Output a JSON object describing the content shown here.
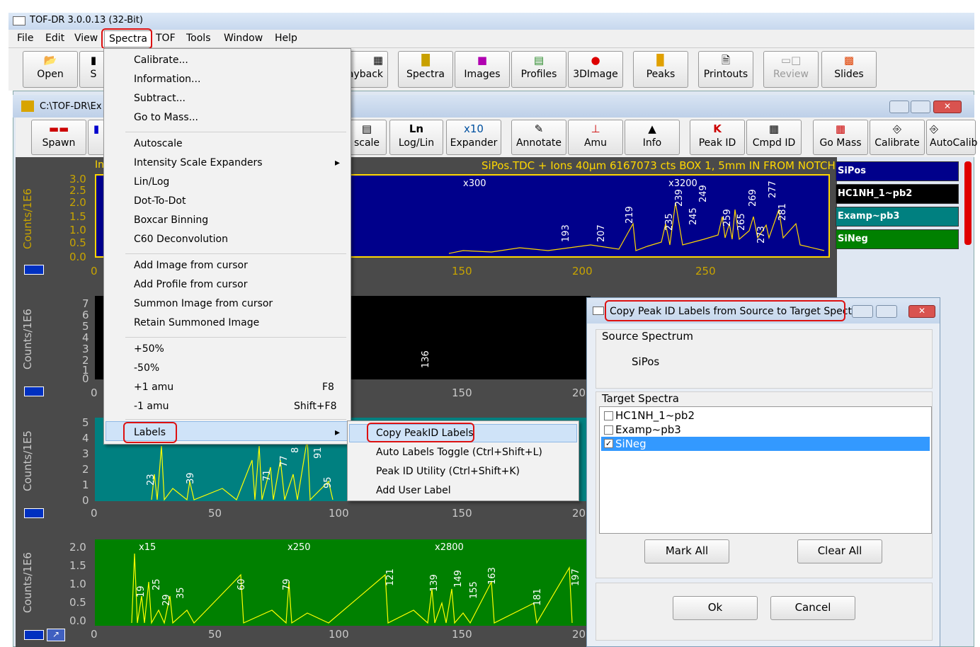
{
  "window": {
    "title": "TOF-DR 3.0.0.13 (32-Bit)"
  },
  "menubar": [
    "File",
    "Edit",
    "View",
    "Spectra",
    "TOF",
    "Tools",
    "Window",
    "Help"
  ],
  "toolbar1": [
    {
      "label": "Open",
      "icon": "folder-icon"
    },
    {
      "label": "S",
      "icon": "save-icon"
    },
    {
      "label": "ayback",
      "icon": "playback-icon"
    },
    {
      "label": "Spectra",
      "icon": "spectra-icon"
    },
    {
      "label": "Images",
      "icon": "images-icon"
    },
    {
      "label": "Profiles",
      "icon": "profiles-icon"
    },
    {
      "label": "3DImage",
      "icon": "3dimage-icon"
    },
    {
      "label": "Peaks",
      "icon": "peaks-icon"
    },
    {
      "label": "Printouts",
      "icon": "printouts-icon"
    },
    {
      "label": "Review",
      "icon": "review-icon",
      "disabled": true
    },
    {
      "label": "Slides",
      "icon": "slides-icon"
    }
  ],
  "child_window": {
    "title": "C:\\TOF-DR\\Ex"
  },
  "toolbar2": [
    {
      "label": "Spawn",
      "icon": "spawn-icon"
    },
    {
      "label": "scale",
      "icon": "scale-icon"
    },
    {
      "label": "Log/Lin",
      "icon": "ln-icon",
      "icon_text": "Ln"
    },
    {
      "label": "Expander",
      "icon": "expander-icon",
      "icon_text": "x10"
    },
    {
      "label": "Annotate",
      "icon": "annotate-icon"
    },
    {
      "label": "Amu",
      "icon": "amu-icon"
    },
    {
      "label": "Info",
      "icon": "info-icon"
    },
    {
      "label": "Peak ID",
      "icon": "peak-id-icon"
    },
    {
      "label": "Cmpd ID",
      "icon": "cmpd-id-icon"
    },
    {
      "label": "Go Mass",
      "icon": "go-mass-icon"
    },
    {
      "label": "Calibrate",
      "icon": "calibrate-icon"
    },
    {
      "label": "AutoCalib",
      "icon": "autocalib-icon"
    }
  ],
  "spectra_menu": {
    "items": [
      {
        "label": "Calibrate..."
      },
      {
        "label": "Information..."
      },
      {
        "label": "Subtract..."
      },
      {
        "label": "Go to Mass..."
      },
      {
        "label": "Autoscale"
      },
      {
        "label": "Intensity Scale Expanders",
        "submenu": true
      },
      {
        "label": "Lin/Log"
      },
      {
        "label": "Dot-To-Dot"
      },
      {
        "label": "Boxcar Binning"
      },
      {
        "label": "C60 Deconvolution"
      },
      {
        "label": "Add Image from cursor"
      },
      {
        "label": "Add Profile from cursor"
      },
      {
        "label": "Summon Image from cursor"
      },
      {
        "label": "Retain Summoned Image"
      },
      {
        "label": "+50%"
      },
      {
        "label": "-50%"
      },
      {
        "label": "+1 amu",
        "shortcut": "F8"
      },
      {
        "label": "-1 amu",
        "shortcut": "Shift+F8"
      },
      {
        "label": "Labels",
        "submenu": true
      }
    ]
  },
  "labels_submenu": [
    "Copy PeakID Labels",
    "Auto Labels Toggle (Ctrl+Shift+L)",
    "Peak ID Utility (Ctrl+Shift+K)",
    "Add User Label"
  ],
  "plot1": {
    "ylabel": "Counts/1E6",
    "yticks": [
      "3.0",
      "2.5",
      "2.0",
      "1.5",
      "1.0",
      "0.5",
      "0.0"
    ],
    "xticks": [
      "0",
      "150",
      "200",
      "250"
    ],
    "header": "SiPos.TDC + Ions 40µm 6167073 cts BOX 1, 5mm IN FROM NOTCH",
    "in": "In",
    "bg": "#00008b",
    "expanders": [
      "x300",
      "x3200"
    ],
    "peaks": [
      "193",
      "207",
      "219",
      "235",
      "239",
      "245",
      "249",
      "259",
      "265",
      "269",
      "273",
      "277",
      "281"
    ]
  },
  "plot2": {
    "ylabel": "Counts/1E6",
    "yticks": [
      "7",
      "6",
      "5",
      "4",
      "3",
      "2",
      "1",
      "0"
    ],
    "xticks": [
      "0",
      "150",
      "20"
    ],
    "bg": "#000000",
    "peaks": [
      "136"
    ]
  },
  "plot3": {
    "ylabel": "Counts/1E5",
    "yticks": [
      "5",
      "4",
      "3",
      "2",
      "1",
      "0"
    ],
    "xticks": [
      "0",
      "50",
      "100",
      "150",
      "20"
    ],
    "bg": "#008080",
    "peaks": [
      "23",
      "39",
      "71",
      "77",
      "8",
      "91",
      "95"
    ]
  },
  "plot4": {
    "ylabel": "Counts/1E6",
    "yticks": [
      "2.0",
      "1.5",
      "1.0",
      "0.5",
      "0.0"
    ],
    "xticks": [
      "0",
      "50",
      "100",
      "150",
      "20"
    ],
    "bg": "#008000",
    "expanders": [
      "x15",
      "x250",
      "x2800"
    ],
    "peaks": [
      "19",
      "25",
      "29",
      "35",
      "60",
      "79",
      "121",
      "139",
      "149",
      "155",
      "163",
      "181",
      "197"
    ]
  },
  "legend": [
    {
      "name": "SiPos",
      "color": "#00008b"
    },
    {
      "name": "HC1NH_1~pb2",
      "color": "#000000"
    },
    {
      "name": "Examp~pb3",
      "color": "#008080"
    },
    {
      "name": "SiNeg",
      "color": "#008000"
    }
  ],
  "dialog": {
    "title": "Copy Peak ID Labels from Source to Target Spectra",
    "source_label": "Source Spectrum",
    "source_value": "SiPos",
    "target_label": "Target Spectra",
    "targets": [
      {
        "name": "HC1NH_1~pb2",
        "checked": false
      },
      {
        "name": "Examp~pb3",
        "checked": false
      },
      {
        "name": "SiNeg",
        "checked": true
      }
    ],
    "mark_all": "Mark All",
    "clear_all": "Clear All",
    "ok": "Ok",
    "cancel": "Cancel"
  }
}
